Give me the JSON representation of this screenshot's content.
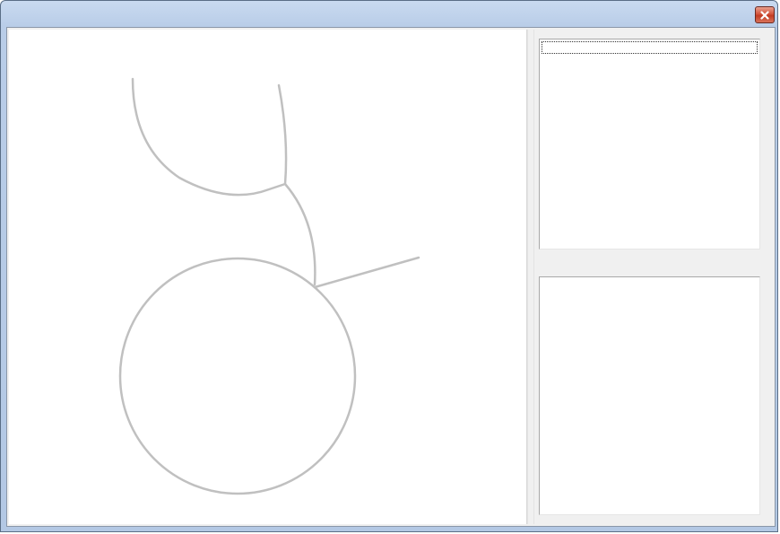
{
  "window": {
    "title": "",
    "close_label": "Close"
  },
  "canvas": {
    "stroke_color": "#c0c0c0",
    "shapes": [
      "upper-arc",
      "connector-curve",
      "branch-line",
      "circle"
    ]
  },
  "list_panel": {
    "items": [
      ""
    ]
  },
  "detail_panel": {
    "text": ""
  }
}
